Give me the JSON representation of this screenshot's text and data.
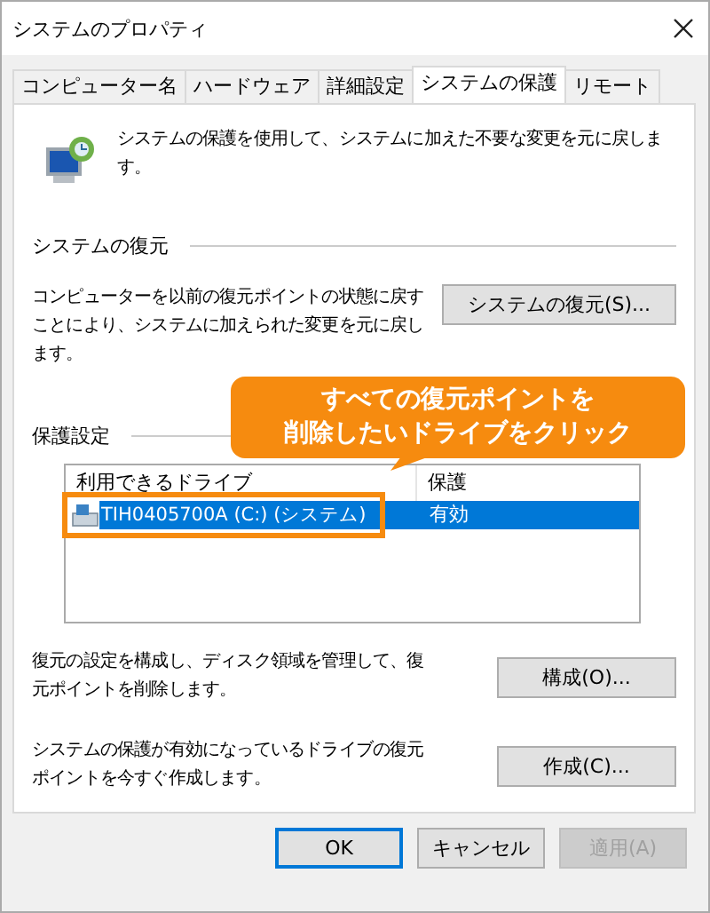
{
  "window": {
    "title": "システムのプロパティ"
  },
  "tabs": [
    {
      "label": "コンピューター名",
      "selected": false
    },
    {
      "label": "ハードウェア",
      "selected": false
    },
    {
      "label": "詳細設定",
      "selected": false
    },
    {
      "label": "システムの保護",
      "selected": true
    },
    {
      "label": "リモート",
      "selected": false
    }
  ],
  "intro": "システムの保護を使用して、システムに加えた不要な変更を元に戻します。",
  "restore": {
    "heading": "システムの復元",
    "text": "コンピューターを以前の復元ポイントの状態に戻すことにより、システムに加えられた変更を元に戻します。",
    "button": "システムの復元(S)..."
  },
  "protection": {
    "heading": "保護設定",
    "columns": [
      "利用できるドライブ",
      "保護"
    ],
    "rows": [
      {
        "drive": "TIH0405700A (C:) (システム)",
        "status": "有効",
        "selected": true,
        "highlighted": true
      }
    ],
    "actions": [
      {
        "text": "復元の設定を構成し、ディスク領域を管理して、復元ポイントを削除します。",
        "button": "構成(O)..."
      },
      {
        "text": "システムの保護が有効になっているドライブの復元ポイントを今すぐ作成します。",
        "button": "作成(C)..."
      }
    ]
  },
  "callout": [
    "すべての復元ポイントを",
    "削除したいドライブをクリック"
  ],
  "buttons": [
    {
      "label": "OK",
      "kind": "default",
      "disabled": false
    },
    {
      "label": "キャンセル",
      "kind": "normal",
      "disabled": false
    },
    {
      "label": "適用(A)",
      "kind": "normal",
      "disabled": true
    }
  ]
}
